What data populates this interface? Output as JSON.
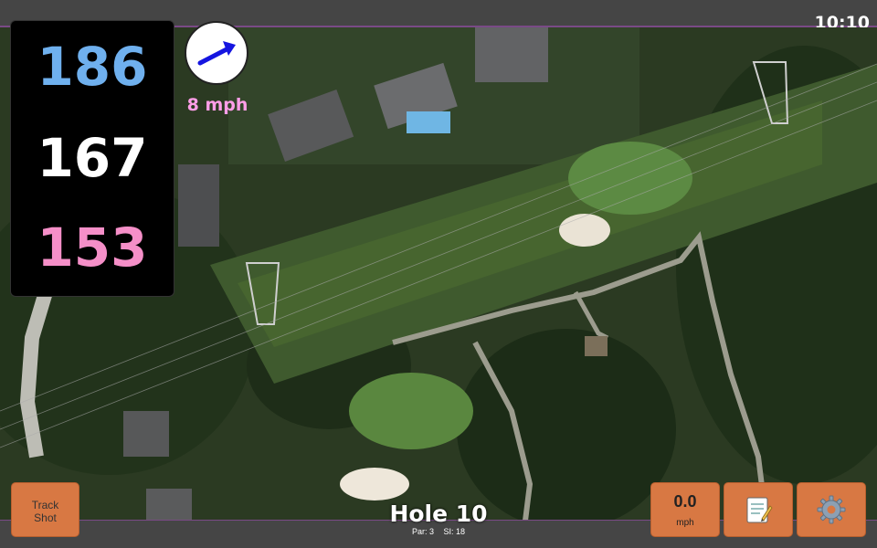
{
  "status_bar": {
    "time": "10:10"
  },
  "distances": {
    "back": "186",
    "middle": "167",
    "front": "153"
  },
  "wind": {
    "speed_label": "8 mph"
  },
  "buttons": {
    "track_shot_line1": "Track",
    "track_shot_line2": "Shot",
    "speed_value": "0.0",
    "speed_unit": "mph",
    "notes_icon": "notepad-icon",
    "settings_icon": "gear-icon"
  },
  "hole": {
    "title": "Hole 10",
    "par": "Par: 3",
    "si": "SI: 18"
  },
  "colors": {
    "back_distance": "#6fb0ee",
    "middle_distance": "#ffffff",
    "front_distance": "#f58fc8",
    "wind_label": "#ff9ee8",
    "button_orange": "#d87843",
    "wind_arrow": "#1515e0"
  }
}
